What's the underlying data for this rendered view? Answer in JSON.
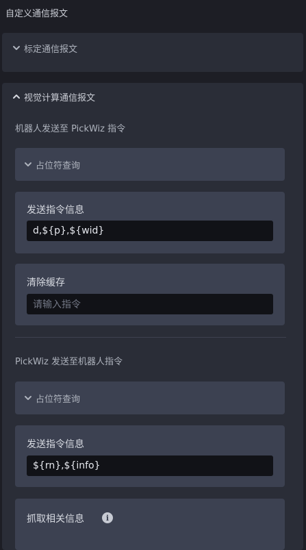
{
  "page": {
    "title": "自定义通信报文"
  },
  "panel_standard": {
    "title": "标定通信报文",
    "expanded": false
  },
  "panel_vision": {
    "title": "视觉计算通信报文",
    "expanded": true,
    "robot_to_pickwiz": {
      "section_label": "机器人发送至 PickWiz 指令",
      "placeholder_query": "占位符查询",
      "send_info": {
        "label": "发送指令信息",
        "value": "d,${p},${wid}"
      },
      "clear_cache": {
        "label": "清除缓存",
        "placeholder": "请输入指令"
      }
    },
    "pickwiz_to_robot": {
      "section_label": "PickWiz 发送至机器人指令",
      "placeholder_query": "占位符查询",
      "send_info": {
        "label": "发送指令信息",
        "value": "${rn},${info}"
      },
      "grab_info": {
        "label": "抓取相关信息",
        "info_icon": "i"
      }
    }
  },
  "colors": {
    "background": "#1d1e25",
    "panel": "#2a2d37",
    "card": "#3c4151",
    "input": "#111217"
  }
}
